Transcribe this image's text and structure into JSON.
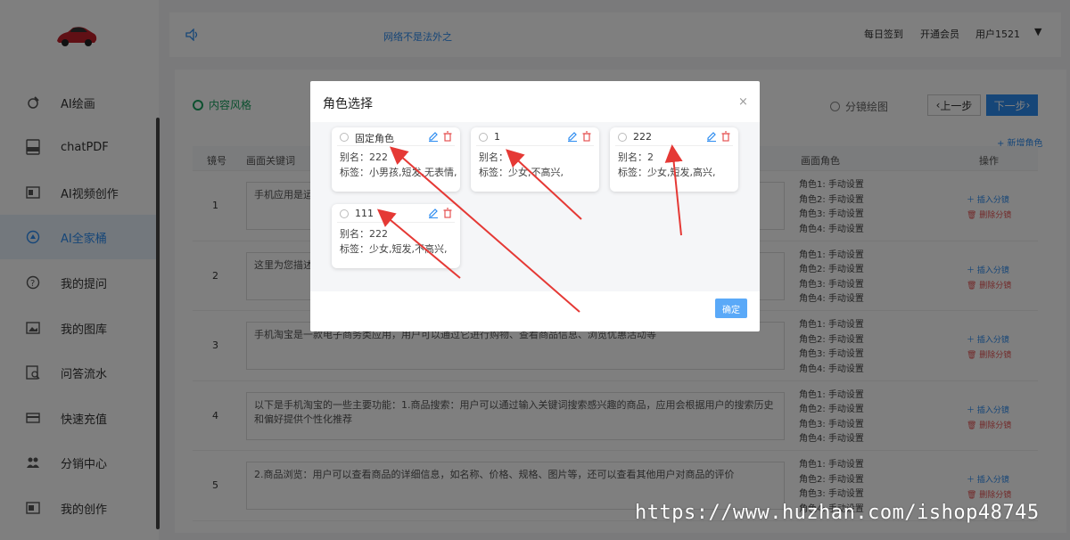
{
  "sidebar": {
    "items": [
      {
        "label": "AI绘画",
        "icon": "brush-icon"
      },
      {
        "label": "chatPDF",
        "icon": "pdf-icon"
      },
      {
        "label": "AI视频创作",
        "icon": "video-icon"
      },
      {
        "label": "AI全家桶",
        "icon": "compass-icon",
        "active": true
      },
      {
        "label": "我的提问",
        "icon": "question-icon"
      },
      {
        "label": "我的图库",
        "icon": "image-icon"
      },
      {
        "label": "问答流水",
        "icon": "search-doc-icon"
      },
      {
        "label": "快速充值",
        "icon": "card-icon"
      },
      {
        "label": "分销中心",
        "icon": "users-icon"
      },
      {
        "label": "我的创作",
        "icon": "creation-icon"
      }
    ]
  },
  "header": {
    "marquee": "网络不是法外之",
    "checkin": "每日签到",
    "membership": "开通会员",
    "user": "用户1521",
    "caret": "▼"
  },
  "toolbar": {
    "style_label": "内容风格",
    "storyboard_label": "分镜绘图",
    "prev_label": "上一步",
    "next_label": "下一步",
    "add_role": "+ 新增角色"
  },
  "table": {
    "headers": {
      "num": "镜号",
      "keywords": "画面关键词",
      "roles": "画面角色",
      "actions": "操作"
    },
    "role_lines": [
      "角色1: 手动设置",
      "角色2: 手动设置",
      "角色3: 手动设置",
      "角色4: 手动设置"
    ],
    "insert_label": "插入分镜",
    "delete_label": "删除分镜",
    "rows": [
      {
        "num": "1",
        "text": "手机应用是运行"
      },
      {
        "num": "2",
        "text": "这里为您描述一"
      },
      {
        "num": "3",
        "text": "手机淘宝是一款电子商务类应用，用户可以通过它进行购物、查看商品信息、浏览优惠活动等"
      },
      {
        "num": "4",
        "text": "以下是手机淘宝的一些主要功能：1.商品搜索：用户可以通过输入关键词搜索感兴趣的商品，应用会根据用户的搜索历史和偏好提供个性化推荐"
      },
      {
        "num": "5",
        "text": "2.商品浏览：用户可以查看商品的详细信息，如名称、价格、规格、图片等，还可以查看其他用户对商品的评价"
      }
    ]
  },
  "modal": {
    "title": "角色选择",
    "close": "×",
    "confirm": "确定",
    "cards": [
      {
        "name": "固定角色",
        "alias": "别名：222",
        "tags": "标签：小男孩,短发,无表情,"
      },
      {
        "name": "1",
        "alias": "别名：",
        "tags": "标签：少女,不高兴,"
      },
      {
        "name": "222",
        "alias": "别名：2",
        "tags": "标签：少女,短发,高兴,"
      },
      {
        "name": "111",
        "alias": "别名：222",
        "tags": "标签：少女,短发,不高兴,"
      }
    ]
  },
  "watermark": "https://www.huzhan.com/ishop48745",
  "colors": {
    "accent": "#2d8cf0",
    "danger": "#e55353",
    "success": "#19a15f",
    "annotation": "#e53935"
  }
}
